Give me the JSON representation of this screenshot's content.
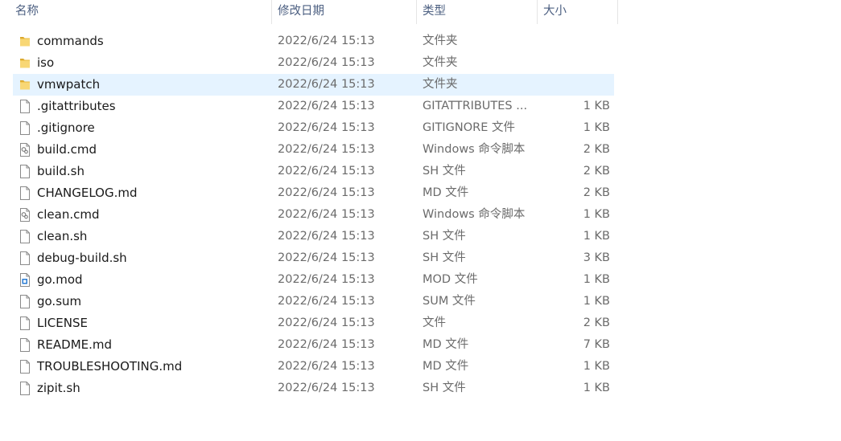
{
  "header": {
    "name": "名称",
    "date": "修改日期",
    "type": "类型",
    "size": "大小",
    "sort_glyph": "^"
  },
  "files": [
    {
      "name": "commands",
      "date": "2022/6/24 15:13",
      "type": "文件夹",
      "size": "",
      "icon": "folder-icon"
    },
    {
      "name": "iso",
      "date": "2022/6/24 15:13",
      "type": "文件夹",
      "size": "",
      "icon": "folder-icon"
    },
    {
      "name": "vmwpatch",
      "date": "2022/6/24 15:13",
      "type": "文件夹",
      "size": "",
      "icon": "folder-icon",
      "selected": true
    },
    {
      "name": ".gitattributes",
      "date": "2022/6/24 15:13",
      "type": "GITATTRIBUTES ...",
      "size": "1 KB",
      "icon": "file-icon"
    },
    {
      "name": ".gitignore",
      "date": "2022/6/24 15:13",
      "type": "GITIGNORE 文件",
      "size": "1 KB",
      "icon": "file-icon"
    },
    {
      "name": "build.cmd",
      "date": "2022/6/24 15:13",
      "type": "Windows 命令脚本",
      "size": "2 KB",
      "icon": "script-icon"
    },
    {
      "name": "build.sh",
      "date": "2022/6/24 15:13",
      "type": "SH 文件",
      "size": "2 KB",
      "icon": "file-icon"
    },
    {
      "name": "CHANGELOG.md",
      "date": "2022/6/24 15:13",
      "type": "MD 文件",
      "size": "2 KB",
      "icon": "file-icon"
    },
    {
      "name": "clean.cmd",
      "date": "2022/6/24 15:13",
      "type": "Windows 命令脚本",
      "size": "1 KB",
      "icon": "script-icon"
    },
    {
      "name": "clean.sh",
      "date": "2022/6/24 15:13",
      "type": "SH 文件",
      "size": "1 KB",
      "icon": "file-icon"
    },
    {
      "name": "debug-build.sh",
      "date": "2022/6/24 15:13",
      "type": "SH 文件",
      "size": "3 KB",
      "icon": "file-icon"
    },
    {
      "name": "go.mod",
      "date": "2022/6/24 15:13",
      "type": "MOD 文件",
      "size": "1 KB",
      "icon": "app-file-icon"
    },
    {
      "name": "go.sum",
      "date": "2022/6/24 15:13",
      "type": "SUM 文件",
      "size": "1 KB",
      "icon": "file-icon"
    },
    {
      "name": "LICENSE",
      "date": "2022/6/24 15:13",
      "type": "文件",
      "size": "2 KB",
      "icon": "file-icon"
    },
    {
      "name": "README.md",
      "date": "2022/6/24 15:13",
      "type": "MD 文件",
      "size": "7 KB",
      "icon": "file-icon"
    },
    {
      "name": "TROUBLESHOOTING.md",
      "date": "2022/6/24 15:13",
      "type": "MD 文件",
      "size": "1 KB",
      "icon": "file-icon"
    },
    {
      "name": "zipit.sh",
      "date": "2022/6/24 15:13",
      "type": "SH 文件",
      "size": "1 KB",
      "icon": "file-icon"
    }
  ]
}
